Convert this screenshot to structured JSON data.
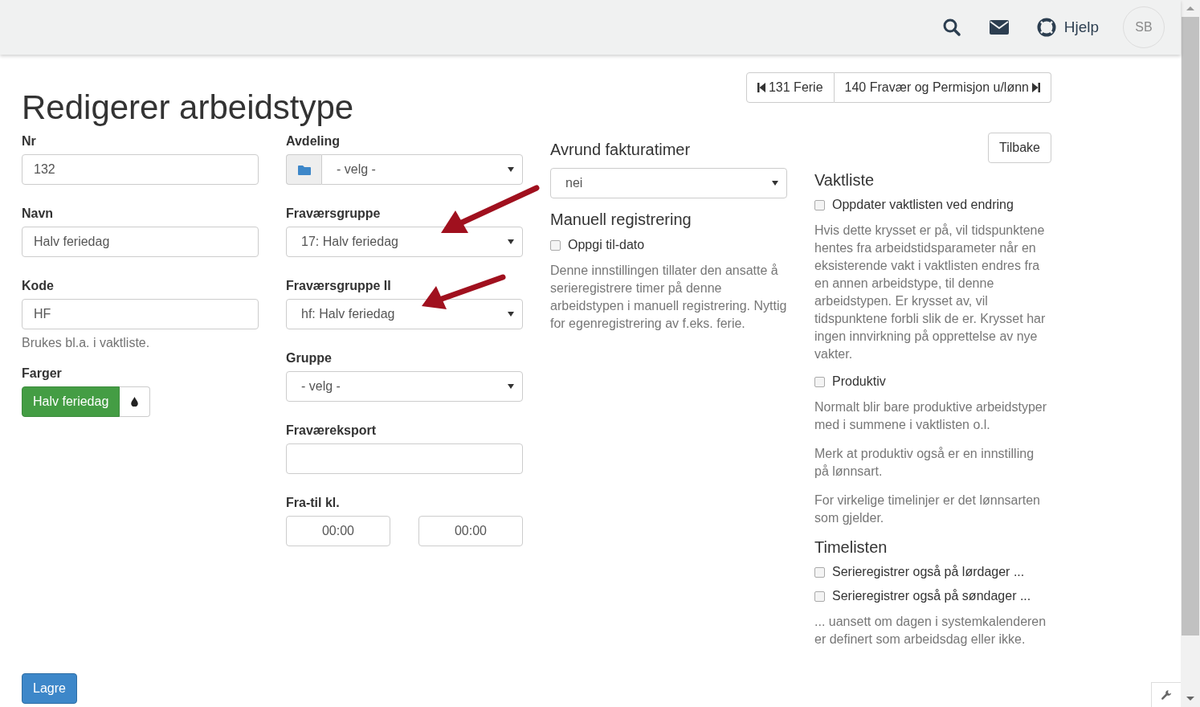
{
  "topbar": {
    "help": "Hjelp",
    "avatar": "SB"
  },
  "nav": {
    "prev": "131 Ferie",
    "next": "140 Fravær og Permisjon u/lønn"
  },
  "title": "Redigerer arbeidstype",
  "back_button": "Tilbake",
  "columns": [
    [
      {
        "kind": "label",
        "text": "Nr"
      },
      {
        "kind": "input",
        "value": "132"
      },
      {
        "kind": "label",
        "text": "Navn"
      },
      {
        "kind": "input",
        "value": "Halv feriedag"
      },
      {
        "kind": "label",
        "text": "Kode"
      },
      {
        "kind": "input",
        "value": "HF"
      },
      {
        "kind": "help",
        "text": "Brukes bl.a. i vaktliste."
      },
      {
        "kind": "label",
        "text": "Farger"
      },
      {
        "kind": "color",
        "text": "Halv feriedag",
        "color": "#449d44"
      }
    ],
    [
      {
        "kind": "label",
        "text": "Avdeling"
      },
      {
        "kind": "select-addon",
        "value": "- velg -"
      },
      {
        "kind": "label",
        "text": "Fraværsgruppe"
      },
      {
        "kind": "select",
        "value": "17: Halv feriedag"
      },
      {
        "kind": "label",
        "text": "Fraværsgruppe II"
      },
      {
        "kind": "select",
        "value": "hf: Halv feriedag"
      },
      {
        "kind": "label",
        "text": "Gruppe"
      },
      {
        "kind": "select",
        "value": "- velg -"
      },
      {
        "kind": "label",
        "text": "Fraværeksport"
      },
      {
        "kind": "input"
      },
      {
        "kind": "label",
        "text": "Fra-til kl."
      },
      {
        "kind": "time-pair",
        "from": "00:00",
        "to": "00:00"
      }
    ],
    [
      {
        "kind": "heading",
        "text": "Avrund fakturatimer"
      },
      {
        "kind": "select",
        "value": "nei"
      },
      {
        "kind": "heading",
        "text": "Manuell registrering"
      },
      {
        "kind": "checkbox",
        "text": "Oppgi til-dato",
        "checked": false
      },
      {
        "kind": "paragraph",
        "text": "Denne innstillingen tillater den ansatte å serieregistrere timer på denne arbeidstypen i manuell registrering. Nyttig for egenregistrering av f.eks. ferie."
      }
    ],
    [
      {
        "kind": "heading",
        "text": "Vaktliste"
      },
      {
        "kind": "checkbox",
        "text": "Oppdater vaktlisten ved endring",
        "checked": false
      },
      {
        "kind": "paragraph",
        "text": "Hvis dette krysset er på, vil tidspunktene hentes fra arbeidstidsparameter når en eksisterende vakt i vaktlisten endres fra en annen arbeidstype, til denne arbeidstypen. Er krysset av, vil tidspunktene forbli slik de er. Krysset har ingen innvirkning på opprettelse av nye vakter."
      },
      {
        "kind": "checkbox",
        "text": "Produktiv",
        "checked": false
      },
      {
        "kind": "paragraph",
        "text": "Normalt blir bare produktive arbeidstyper med i summene i vaktlisten o.l."
      },
      {
        "kind": "paragraph",
        "text": "Merk at produktiv også er en innstilling på lønnsart."
      },
      {
        "kind": "paragraph",
        "text": "For virkelige timelinjer er det lønnsarten som gjelder."
      },
      {
        "kind": "heading",
        "text": "Timelisten"
      },
      {
        "kind": "checkbox",
        "text": "Serieregistrer også på lørdager ...",
        "checked": false
      },
      {
        "kind": "checkbox",
        "text": "Serieregistrer også på søndager ...",
        "checked": false
      },
      {
        "kind": "paragraph",
        "text": "... uansett om dagen i systemkalenderen er definert som arbeidsdag eller ikke."
      }
    ]
  ],
  "save_button": "Lagre"
}
